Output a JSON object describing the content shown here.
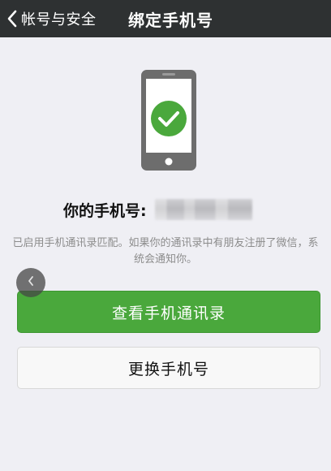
{
  "navbar": {
    "back_label": "帐号与安全",
    "title": "绑定手机号",
    "back_icon": "chevron-left-icon"
  },
  "illustration": {
    "icon": "phone-check-icon",
    "check_color": "#4aa83c",
    "phone_color": "#6d6d6d"
  },
  "phone": {
    "label": "你的手机号:",
    "number_masked": true
  },
  "info": {
    "text": "已启用手机通讯录匹配。如果你的通讯录中有朋友注册了微信，系统会通知你。"
  },
  "float_back": {
    "icon": "chevron-left-icon"
  },
  "buttons": {
    "view_contacts": "查看手机通讯录",
    "change_phone": "更换手机号"
  },
  "colors": {
    "navbar": "#2e3132",
    "accent": "#4aa83c",
    "background": "#efeff4"
  }
}
